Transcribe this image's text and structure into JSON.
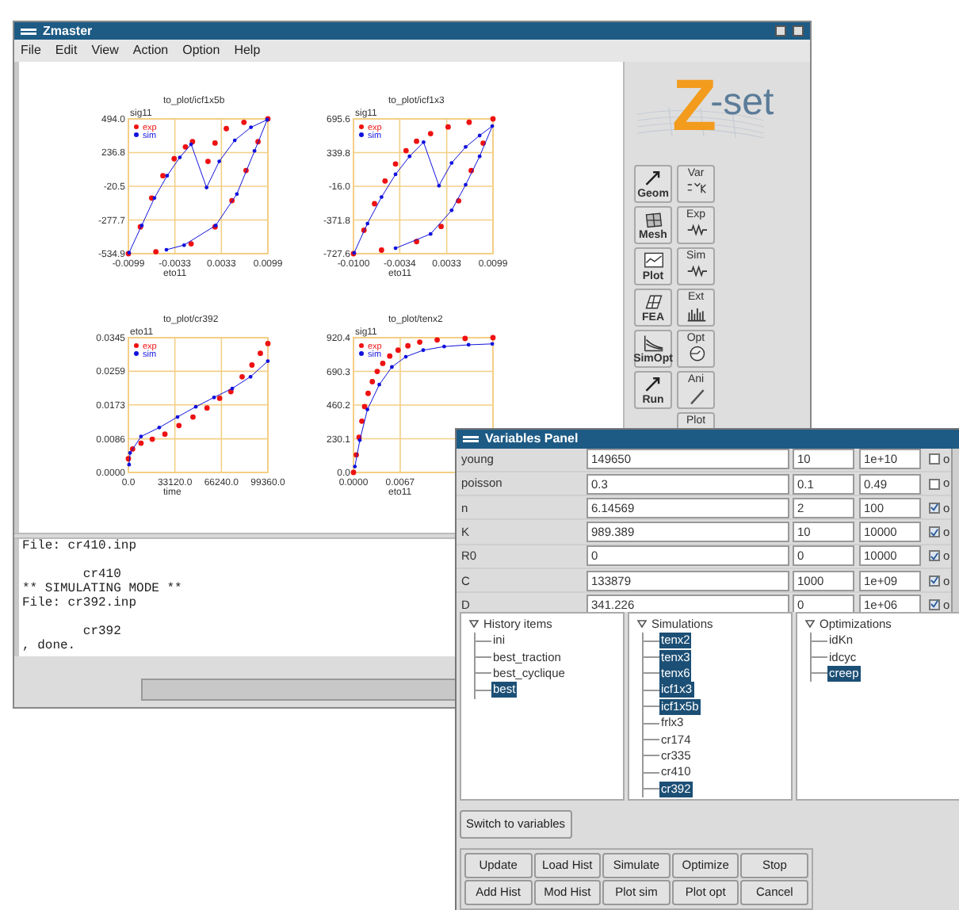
{
  "main_window": {
    "title": "Zmaster",
    "menu": [
      "File",
      "Edit",
      "View",
      "Action",
      "Option",
      "Help"
    ],
    "charts": [
      {
        "chart_data": {
          "type": "scatter",
          "grid": true,
          "legend": "upper left",
          "title": "to_plot/icf1x5b",
          "xlabel": "eto11",
          "ylabel": "sig11",
          "xlim": [
            -0.0099,
            0.0099
          ],
          "ylim": [
            -534.9,
            494.0
          ],
          "xticks": [
            {
              "value": -0.0099,
              "label": "-0.0099"
            },
            {
              "value": -0.0033,
              "label": "-0.0033"
            },
            {
              "value": 0.0033,
              "label": "0.0033"
            },
            {
              "value": 0.0099,
              "label": "0.0099"
            }
          ],
          "yticks": [
            {
              "value": 494.0,
              "label": "494.0"
            },
            {
              "value": 236.8,
              "label": "236.8"
            },
            {
              "value": -20.5,
              "label": "-20.5"
            },
            {
              "value": -277.7,
              "label": "-277.7"
            },
            {
              "value": -534.9,
              "label": "-534.9"
            }
          ],
          "x": [
            -0.0099,
            -0.0082,
            -0.0066,
            -0.005,
            -0.0034,
            -0.0018,
            -0.0008,
            0.0014,
            0.0024,
            0.004,
            0.0065,
            0.0099,
            0.0085,
            0.0068,
            0.0048,
            0.0024,
            -0.001,
            -0.006,
            -0.0098,
            -0.008,
            -0.0062,
            -0.0044,
            -0.0026,
            -0.001,
            0.0012,
            0.003,
            0.0052,
            0.0075,
            0.0098,
            0.008,
            0.0055,
            0.0025,
            -0.002,
            -0.0045
          ],
          "series": [
            {
              "name": "exp",
              "color": "#ee1111",
              "values": [
                -534.9,
                -330,
                -110,
                60,
                190,
                280,
                320,
                170,
                310,
                420,
                468,
                494,
                320,
                100,
                -130,
                -330,
                -460,
                -520,
                null,
                null,
                null,
                null,
                null,
                null,
                null,
                null,
                null,
                null,
                null,
                null,
                null,
                null,
                null,
                null
              ]
            },
            {
              "name": "sim",
              "type": "line",
              "color": "#1111dd",
              "values": [
                null,
                null,
                null,
                null,
                null,
                null,
                null,
                null,
                null,
                null,
                null,
                null,
                null,
                null,
                null,
                null,
                null,
                null,
                -528,
                -320,
                -110,
                60,
                200,
                300,
                -30,
                170,
                330,
                430,
                488,
                250,
                -80,
                -320,
                -470,
                -505
              ]
            }
          ]
        }
      },
      {
        "chart_data": {
          "type": "scatter",
          "grid": true,
          "legend": "upper left",
          "title": "to_plot/icf1x3",
          "xlabel": "eto11",
          "ylabel": "sig11",
          "xlim": [
            -0.01,
            0.0099
          ],
          "ylim": [
            -727.6,
            695.6
          ],
          "xticks": [
            {
              "value": -0.01,
              "label": "-0.0100"
            },
            {
              "value": -0.0034,
              "label": "-0.0034"
            },
            {
              "value": 0.0033,
              "label": "0.0033"
            },
            {
              "value": 0.0099,
              "label": "0.0099"
            }
          ],
          "yticks": [
            {
              "value": 695.6,
              "label": "695.6"
            },
            {
              "value": 339.8,
              "label": "339.8"
            },
            {
              "value": -16.0,
              "label": "-16.0"
            },
            {
              "value": -371.8,
              "label": "-371.8"
            },
            {
              "value": -727.6,
              "label": "-727.6"
            }
          ],
          "x": [
            -0.01,
            -0.0085,
            -0.007,
            -0.0055,
            -0.004,
            -0.0025,
            -0.001,
            0.001,
            0.0035,
            0.0065,
            0.0099,
            0.0085,
            0.0068,
            0.005,
            0.0025,
            -0.001,
            -0.006,
            -0.0099,
            -0.008,
            -0.006,
            -0.004,
            -0.002,
            0.0,
            0.0022,
            0.004,
            0.006,
            0.008,
            0.0098,
            0.008,
            0.006,
            0.004,
            0.001,
            -0.004
          ],
          "series": [
            {
              "name": "exp",
              "color": "#ee1111",
              "values": [
                -727.6,
                -480,
                -200,
                40,
                220,
                360,
                460,
                540,
                610,
                660,
                695.6,
                440,
                150,
                -170,
                -440,
                -600,
                -690,
                null,
                null,
                null,
                null,
                null,
                null,
                null,
                null,
                null,
                null,
                null,
                null,
                null,
                null,
                null,
                null
              ]
            },
            {
              "name": "sim",
              "type": "line",
              "color": "#1111dd",
              "values": [
                null,
                null,
                null,
                null,
                null,
                null,
                null,
                null,
                null,
                null,
                null,
                null,
                null,
                null,
                null,
                null,
                null,
                -720,
                -410,
                -130,
                110,
                300,
                450,
                -10,
                230,
                400,
                520,
                620,
                300,
                0,
                -270,
                -520,
                -670
              ]
            }
          ]
        }
      },
      {
        "chart_data": {
          "type": "scatter",
          "grid": true,
          "legend": "upper left",
          "title": "to_plot/cr392",
          "xlabel": "time",
          "ylabel": "eto11",
          "xlim": [
            0,
            99360
          ],
          "ylim": [
            0,
            0.0345
          ],
          "xticks": [
            {
              "value": 0,
              "label": "0.0"
            },
            {
              "value": 33120,
              "label": "33120.0"
            },
            {
              "value": 66240,
              "label": "66240.0"
            },
            {
              "value": 99360,
              "label": "99360.0"
            }
          ],
          "yticks": [
            {
              "value": 0.0345,
              "label": "0.0345"
            },
            {
              "value": 0.0259,
              "label": "0.0259"
            },
            {
              "value": 0.0173,
              "label": "0.0173"
            },
            {
              "value": 0.0086,
              "label": "0.0086"
            },
            {
              "value": 0,
              "label": "0.0000"
            }
          ],
          "x": [
            0,
            3000,
            9000,
            17000,
            26000,
            36000,
            46000,
            56000,
            65000,
            73000,
            81000,
            88000,
            94000,
            99360,
            500,
            1200,
            9000,
            22000,
            35000,
            48000,
            61000,
            74000,
            87000,
            99300
          ],
          "series": [
            {
              "name": "exp",
              "color": "#ee1111",
              "values": [
                0.0035,
                0.006,
                0.0075,
                0.0085,
                0.0098,
                0.012,
                0.0142,
                0.0165,
                0.019,
                0.0207,
                0.0245,
                0.0275,
                0.0305,
                0.033,
                null,
                null,
                null,
                null,
                null,
                null,
                null,
                null,
                null,
                null
              ]
            },
            {
              "name": "sim",
              "type": "line",
              "color": "#1111dd",
              "values": [
                null,
                null,
                null,
                null,
                null,
                null,
                null,
                null,
                null,
                null,
                null,
                null,
                null,
                null,
                0.002,
                0.005,
                0.0092,
                0.0115,
                0.0142,
                0.0168,
                0.0192,
                0.0215,
                0.0245,
                0.0285
              ]
            }
          ]
        }
      },
      {
        "chart_data": {
          "type": "scatter",
          "grid": true,
          "legend": "upper left",
          "title": "to_plot/tenx2",
          "xlabel": "eto11",
          "ylabel": "sig11",
          "xlim": [
            0,
            0.02
          ],
          "ylim": [
            0,
            920.4
          ],
          "xticks": [
            {
              "value": 0,
              "label": "0.0000"
            },
            {
              "value": 0.0067,
              "label": "0.0067"
            }
          ],
          "yticks": [
            {
              "value": 920.4,
              "label": "920.4"
            },
            {
              "value": 690.3,
              "label": "690.3"
            },
            {
              "value": 460.2,
              "label": "460.2"
            },
            {
              "value": 230.1,
              "label": "230.1"
            },
            {
              "value": 0,
              "label": "0.0"
            }
          ],
          "x": [
            0,
            0.0004,
            0.0008,
            0.0012,
            0.0016,
            0.0021,
            0.0027,
            0.0034,
            0.0042,
            0.0052,
            0.0064,
            0.0078,
            0.0095,
            0.012,
            0.016,
            0.02,
            0.0002,
            0.0009,
            0.002,
            0.0037,
            0.0055,
            0.0075,
            0.01,
            0.013,
            0.0165,
            0.0199
          ],
          "series": [
            {
              "name": "exp",
              "color": "#ee1111",
              "values": [
                0,
                120,
                240,
                350,
                450,
                540,
                620,
                690,
                745,
                795,
                835,
                865,
                890,
                905,
                915,
                920.4,
                null,
                null,
                null,
                null,
                null,
                null,
                null,
                null,
                null,
                null
              ]
            },
            {
              "name": "sim",
              "type": "line",
              "color": "#1111dd",
              "values": [
                null,
                null,
                null,
                null,
                null,
                null,
                null,
                null,
                null,
                null,
                null,
                null,
                null,
                null,
                null,
                null,
                40,
                220,
                430,
                600,
                720,
                790,
                835,
                860,
                872,
                878
              ]
            }
          ]
        }
      }
    ],
    "console": "File: cr410.inp\n\n        cr410\n** SIMULATING MODE **\nFile: cr392.inp\n\n        cr392\n, done.",
    "logo": {
      "mark": "Z",
      "text": "-set"
    },
    "tool_columns": [
      [
        {
          "label": "Geom",
          "kind": "arrow"
        },
        {
          "label": "Mesh",
          "kind": "mesh"
        },
        {
          "label": "Plot",
          "kind": "graph"
        },
        {
          "label": "FEA",
          "kind": "grid"
        },
        {
          "label": "SimOpt",
          "kind": "curves"
        },
        {
          "label": "Run",
          "kind": "arrow"
        }
      ],
      [
        {
          "label": "Var",
          "kind": "formula"
        },
        {
          "label": "Exp",
          "kind": "spring"
        },
        {
          "label": "Sim",
          "kind": "spring"
        },
        {
          "label": "Ext",
          "kind": "bars"
        },
        {
          "label": "Opt",
          "kind": "dial"
        },
        {
          "label": "Ani",
          "kind": "pen"
        },
        {
          "label": "Plot",
          "kind": "none"
        }
      ]
    ]
  },
  "variables_panel": {
    "title": "Variables Panel",
    "rows": [
      {
        "name": "young",
        "value": "149650",
        "min": "10",
        "max": "1e+10",
        "checked": false,
        "flag": "o"
      },
      {
        "name": "poisson",
        "value": "0.3",
        "min": "0.1",
        "max": "0.49",
        "checked": false,
        "flag": "o"
      },
      {
        "name": "n",
        "value": "6.14569",
        "min": "2",
        "max": "100",
        "checked": true,
        "flag": "o"
      },
      {
        "name": "K",
        "value": "989.389",
        "min": "10",
        "max": "10000",
        "checked": true,
        "flag": "o"
      },
      {
        "name": "R0",
        "value": "0",
        "min": "0",
        "max": "10000",
        "checked": true,
        "flag": "o"
      },
      {
        "name": "C",
        "value": "133879",
        "min": "1000",
        "max": "1e+09",
        "checked": true,
        "flag": "o"
      },
      {
        "name": "D",
        "value": "341.226",
        "min": "0",
        "max": "1e+06",
        "checked": true,
        "flag": "o"
      }
    ],
    "trees": [
      {
        "title": "History items",
        "expanded": true,
        "items": [
          {
            "label": "ini",
            "selected": false
          },
          {
            "label": "best_traction",
            "selected": false
          },
          {
            "label": "best_cyclique",
            "selected": false
          },
          {
            "label": "best",
            "selected": true
          }
        ]
      },
      {
        "title": "Simulations",
        "expanded": true,
        "items": [
          {
            "label": "tenx2",
            "selected": true
          },
          {
            "label": "tenx3",
            "selected": true
          },
          {
            "label": "tenx6",
            "selected": true
          },
          {
            "label": "icf1x3",
            "selected": true
          },
          {
            "label": "icf1x5b",
            "selected": true
          },
          {
            "label": "frlx3",
            "selected": false
          },
          {
            "label": "cr174",
            "selected": false
          },
          {
            "label": "cr335",
            "selected": false
          },
          {
            "label": "cr410",
            "selected": false
          },
          {
            "label": "cr392",
            "selected": true
          }
        ]
      },
      {
        "title": "Optimizations",
        "expanded": true,
        "items": [
          {
            "label": "idKn",
            "selected": false
          },
          {
            "label": "idcyc",
            "selected": false
          },
          {
            "label": "creep",
            "selected": true
          }
        ]
      }
    ],
    "switch_button": "Switch to variables",
    "button_rows": [
      [
        "Update",
        "Load Hist",
        "Simulate",
        "Optimize",
        "Stop"
      ],
      [
        "Add Hist",
        "Mod Hist",
        "Plot sim",
        "Plot opt",
        "Cancel"
      ]
    ]
  }
}
